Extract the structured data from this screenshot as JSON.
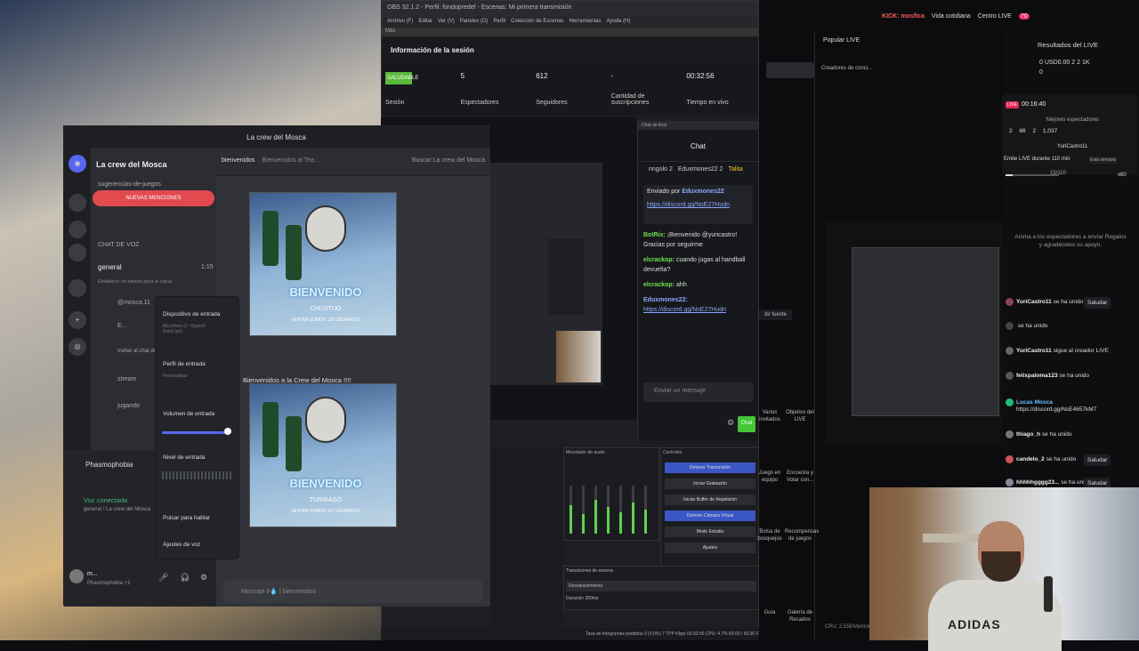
{
  "obs": {
    "title": "OBS 32.1.2 - Perfil: fondopredef - Escenas: Mi primera transmisión",
    "menu": [
      "Archivo (F)",
      "Editar",
      "Ver (V)",
      "Paneles (D)",
      "Perfil",
      "Colección de Escenas",
      "Herramientas",
      "Ayuda (H)"
    ],
    "dock_label": "Más",
    "session_title": "Información de la sesión",
    "status_badge": "SALUDABLE",
    "stats": [
      {
        "value": "",
        "label": "Sesión"
      },
      {
        "value": "5",
        "label": "Espectadores"
      },
      {
        "value": "612",
        "label": "Seguidores"
      },
      {
        "value": "-",
        "label": "Cantidad de suscripciones"
      },
      {
        "value": "00:32:56",
        "label": "Tiempo en vivo"
      }
    ],
    "mixer_title": "Mezclador de audio",
    "controls_title": "Controles",
    "controls": [
      "Detener Transmisión",
      "Iniciar Grabación",
      "Iniciar Buffer de Repetición",
      "Detener Cámara Virtual",
      "Modo Estudio",
      "Ajustes"
    ],
    "transitions_title": "Transiciones de escena",
    "transition_value": "Desvanecimiento",
    "duration_label": "Duración",
    "duration_value": "300ms",
    "status_bar": "Tasa de fotogramas perdidos 0 (0.0%) 7 TPP Kbps 00:32:56 CPU: 4.7% 60.00 / 60.00 FPS"
  },
  "chat": {
    "dock_label": "Chat de Kick",
    "title": "Chat",
    "top": [
      "nngolo 2",
      "Eduxmones22 2",
      "Talita"
    ],
    "pinned_by_label": "Enviado por",
    "pinned_user": "Eduxmones22",
    "pinned_link": "https://discord.gg/NsE27Hudn",
    "messages": [
      {
        "user": "BotRix:",
        "text": "¡Bienvenido @yuricastro! Gracias por seguirme"
      },
      {
        "user": "elcrackop:",
        "text": "cuando jugas al handball devuelta?"
      },
      {
        "user": "elcrackop:",
        "text": "ahh"
      },
      {
        "user": "Eduxmones22:",
        "text": "https://discord.gg/NsE27Hudn"
      }
    ],
    "input_placeholder": "Enviar un mensaje",
    "send_label": "Chat"
  },
  "discord": {
    "window_title": "La crew del Mosca",
    "guild_name": "La crew del Mosca",
    "channel_top": "sugerencias-de-juegos",
    "mentions_label": "NUEVAS MENCIONES",
    "voice_category": "CHAT DE VOZ",
    "general_channel": "general",
    "general_time": "1:15",
    "status_hint": "Establece un estado para el canal",
    "member_1": "@mosca.11",
    "member_2": "E...",
    "invite_hint": "Invitar al chat de",
    "stream_channel": "stream",
    "jugando_channel": "jugando",
    "activity_name": "Phasmophobia",
    "voice_connected": "Voz conectada",
    "voice_location": "general / La crew del Mosca",
    "username": "m...",
    "user_status": "Phasmophobia +1",
    "channel_header": "bienvenidos",
    "channel_topic": "Bienvenidos al Tea...",
    "search_placeholder": "Buscar La crew del Mosca",
    "banner_big": "BIENVENIDO",
    "banner_name_1": "CHUSTUO",
    "banner_name_2": "TURIXAGO",
    "banner_sub": "¡AHORA SOMOS 126 USUARIOS!",
    "banner_sub_2": "¡AHORA SOMOS 127 USUARIOS!",
    "welcome_text": "Bienvenidos a la Crew del Mosca !!!!",
    "message_placeholder": "Mensaje #💧 | bienvenidos",
    "popup": {
      "input_device": "Dispositivo de entrada",
      "input_device_value": "Micrófono (2- HyperX SoloCast)",
      "input_profile": "Perfil de entrada",
      "input_profile_value": "Personalizar",
      "input_volume": "Volumen de entrada",
      "input_volume_fraction": 0.95,
      "input_level": "Nivel de entrada",
      "push_to_talk": "Pulsar para hablar",
      "voice_settings": "Ajustes de voz"
    }
  },
  "tiktok": {
    "kick_label": "KICK: mosfica",
    "popular": "Popular LIVE",
    "creators": "Creadores de conci...",
    "vida": "Vida cotidiana",
    "centro": "Centro LIVE",
    "notif_count": "70",
    "results_title": "Resultados del LIVE",
    "results_stats": [
      "0",
      "USD0.00",
      "2",
      "2",
      "1K",
      "0"
    ],
    "live_time": "00:16:40",
    "best_viewers": "Mejores espectadores",
    "live_stats": [
      "2",
      "66",
      "2",
      "1,037"
    ],
    "top_user": "YuriCastro11",
    "emit_task": "Emite LIVE durante 110 min",
    "week_label": "Esta semana",
    "task_progress": "15/110",
    "gift_count": "x60",
    "gift_hint": "Anima a los espectadores a enviar Regalos y agradéceles su apoyo.",
    "add_source": "dir fuente",
    "tools": [
      "Varios invitados",
      "Objetivo del LIVE",
      "Juego en equipo",
      "Encuesta y Votar con...",
      "Bolsa de bosquejos",
      "Recompensas de juegos",
      "Guía",
      "Galería de Recados"
    ],
    "cpu": "CPU: 2.558",
    "memory": "Memoria",
    "events": [
      {
        "user": "YuriCastro11",
        "text": "se ha unido",
        "saludar": "Saludar"
      },
      {
        "user": "",
        "text": "se ha unido",
        "saludar": ""
      },
      {
        "user": "YuriCastro11",
        "text": "sigue al creador LIVE",
        "saludar": ""
      },
      {
        "user": "felixpaloma123",
        "text": "se ha unido",
        "saludar": ""
      },
      {
        "user": "Lucas Mosca",
        "text": "https://discord.gg/NsE4657kM7",
        "saludar": ""
      },
      {
        "user": "thiago_h",
        "text": "se ha unido",
        "saludar": ""
      },
      {
        "user": "candelo_2",
        "text": "se ha unido",
        "saludar": "Saludar"
      },
      {
        "user": "hhhhhgggg23...",
        "text": "se ha unido",
        "saludar": "Saludar"
      }
    ]
  },
  "webcam": {
    "shirt_text": "ADIDAS"
  }
}
